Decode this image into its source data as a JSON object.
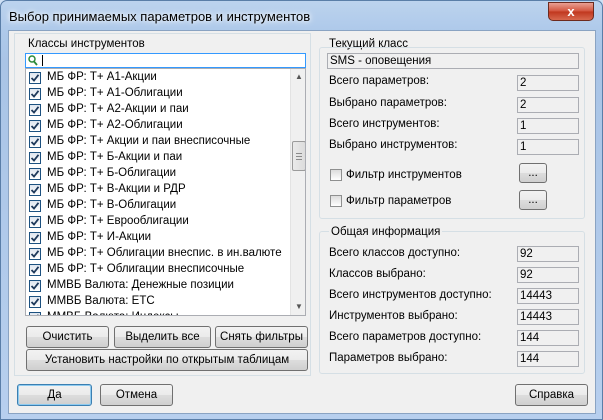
{
  "window": {
    "title": "Выбор принимаемых параметров и инструментов",
    "close_label": "x"
  },
  "classes_panel": {
    "title": "Классы инструментов",
    "search_value": "",
    "items": [
      {
        "label": "МБ ФР: Т+ А1-Акции",
        "checked": true
      },
      {
        "label": "МБ ФР: Т+ А1-Облигации",
        "checked": true
      },
      {
        "label": "МБ ФР: Т+ А2-Акции и паи",
        "checked": true
      },
      {
        "label": "МБ ФР: Т+ А2-Облигации",
        "checked": true
      },
      {
        "label": "МБ ФР: Т+ Акции и паи внесписочные",
        "checked": true
      },
      {
        "label": "МБ ФР: Т+ Б-Акции и паи",
        "checked": true
      },
      {
        "label": "МБ ФР: Т+ Б-Облигации",
        "checked": true
      },
      {
        "label": "МБ ФР: Т+ В-Акции и РДР",
        "checked": true
      },
      {
        "label": "МБ ФР: Т+ В-Облигации",
        "checked": true
      },
      {
        "label": "МБ ФР: Т+ Еврооблигации",
        "checked": true
      },
      {
        "label": "МБ ФР: Т+ И-Акции",
        "checked": true
      },
      {
        "label": "МБ ФР: Т+ Облигации внеспис. в ин.валюте",
        "checked": true
      },
      {
        "label": "МБ ФР: Т+ Облигации внесписочные",
        "checked": true
      },
      {
        "label": "ММВБ Валюта: Денежные позиции",
        "checked": true
      },
      {
        "label": "ММВБ Валюта: ETC",
        "checked": true
      },
      {
        "label": "ММВБ Валюта: Индексы",
        "checked": true
      }
    ],
    "buttons": {
      "clear": "Очистить",
      "select_all": "Выделить все",
      "remove_filters": "Снять фильтры",
      "apply_open_tables": "Установить настройки по открытым  таблицам"
    }
  },
  "current_class": {
    "title": "Текущий класс",
    "name": "SMS - оповещения",
    "rows": [
      {
        "label": "Всего параметров:",
        "value": "2"
      },
      {
        "label": "Выбрано параметров:",
        "value": "2"
      },
      {
        "label": "Всего инструментов:",
        "value": "1"
      },
      {
        "label": "Выбрано инструментов:",
        "value": "1"
      }
    ],
    "filters": [
      {
        "label": "Фильтр инструментов",
        "checked": false,
        "button": "..."
      },
      {
        "label": "Фильтр параметров",
        "checked": false,
        "button": "..."
      }
    ]
  },
  "general_info": {
    "title": "Общая информация",
    "rows": [
      {
        "label": "Всего классов доступно:",
        "value": "92"
      },
      {
        "label": "Классов выбрано:",
        "value": "92"
      },
      {
        "label": "Всего инструментов доступно:",
        "value": "14443"
      },
      {
        "label": "Инструментов выбрано:",
        "value": "14443"
      },
      {
        "label": "Всего параметров доступно:",
        "value": "144"
      },
      {
        "label": "Параметров выбрано:",
        "value": "144"
      }
    ]
  },
  "footer": {
    "ok": "Да",
    "cancel": "Отмена",
    "help": "Справка"
  }
}
